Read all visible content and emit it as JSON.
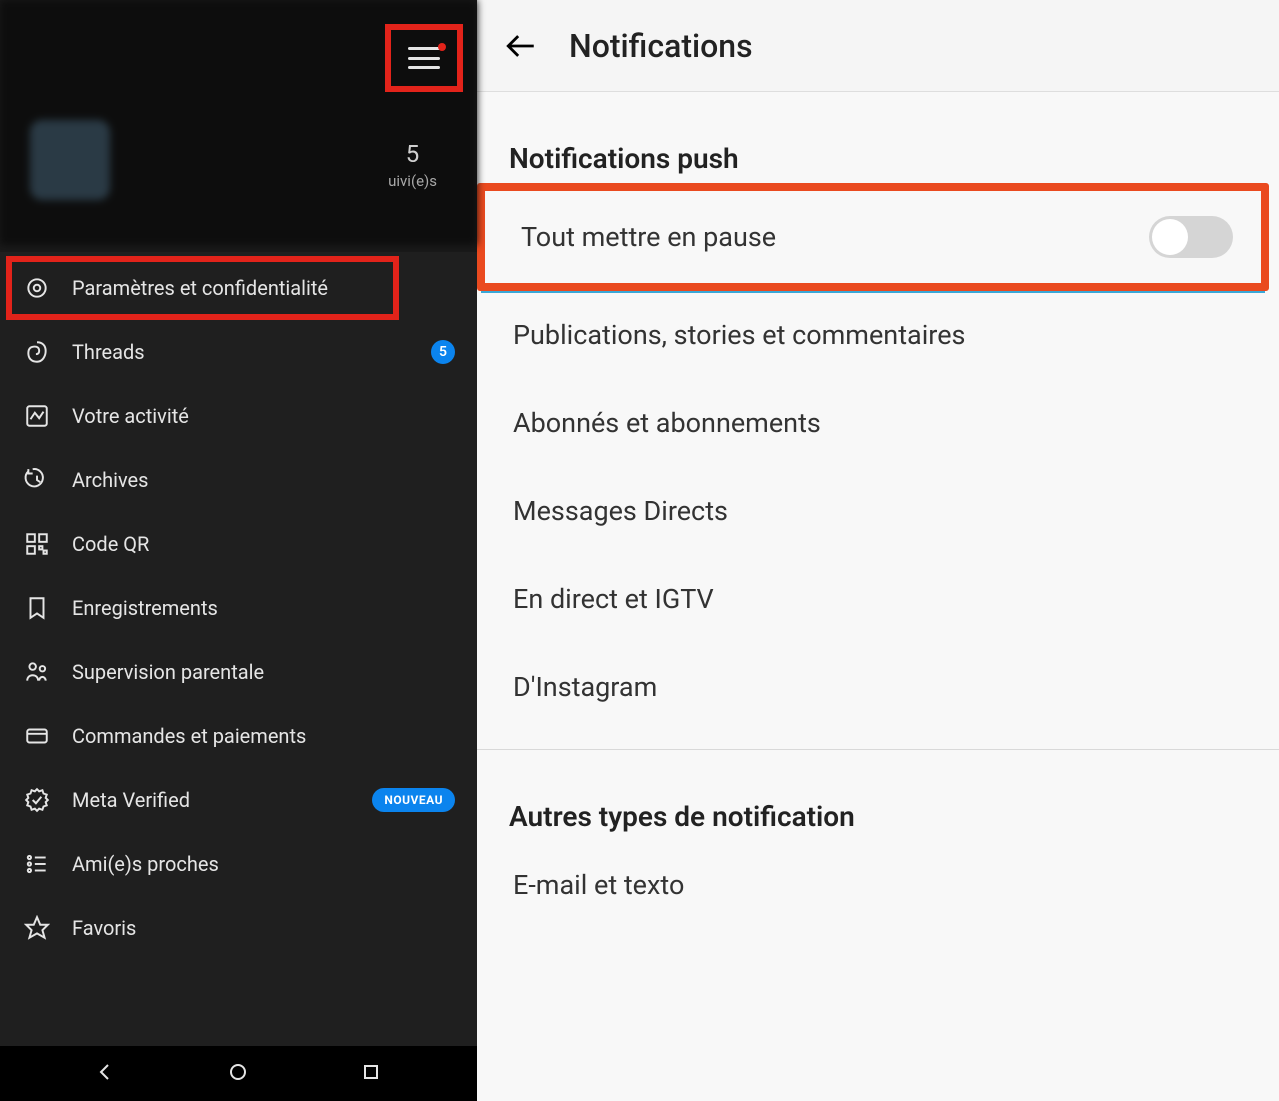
{
  "left": {
    "stat": {
      "count": "5",
      "label": "uivi(e)s"
    },
    "menu": [
      {
        "icon": "gear",
        "label": "Paramètres et confidentialité",
        "highlight": true
      },
      {
        "icon": "threads",
        "label": "Threads",
        "badge_num": "5"
      },
      {
        "icon": "activity",
        "label": "Votre activité"
      },
      {
        "icon": "archive",
        "label": "Archives"
      },
      {
        "icon": "qr",
        "label": "Code QR"
      },
      {
        "icon": "bookmark",
        "label": "Enregistrements"
      },
      {
        "icon": "family",
        "label": "Supervision parentale"
      },
      {
        "icon": "card",
        "label": "Commandes et paiements"
      },
      {
        "icon": "verified",
        "label": "Meta Verified",
        "badge_pill": "NOUVEAU"
      },
      {
        "icon": "list",
        "label": "Ami(e)s proches"
      },
      {
        "icon": "star",
        "label": "Favoris"
      }
    ]
  },
  "right": {
    "title": "Notifications",
    "section1": "Notifications push",
    "pause_row": "Tout mettre en pause",
    "items1": [
      "Publications, stories et commentaires",
      "Abonnés et abonnements",
      "Messages Directs",
      "En direct et IGTV",
      "D'Instagram"
    ],
    "section2": "Autres types de notification",
    "items2": [
      "E-mail et texto"
    ]
  }
}
